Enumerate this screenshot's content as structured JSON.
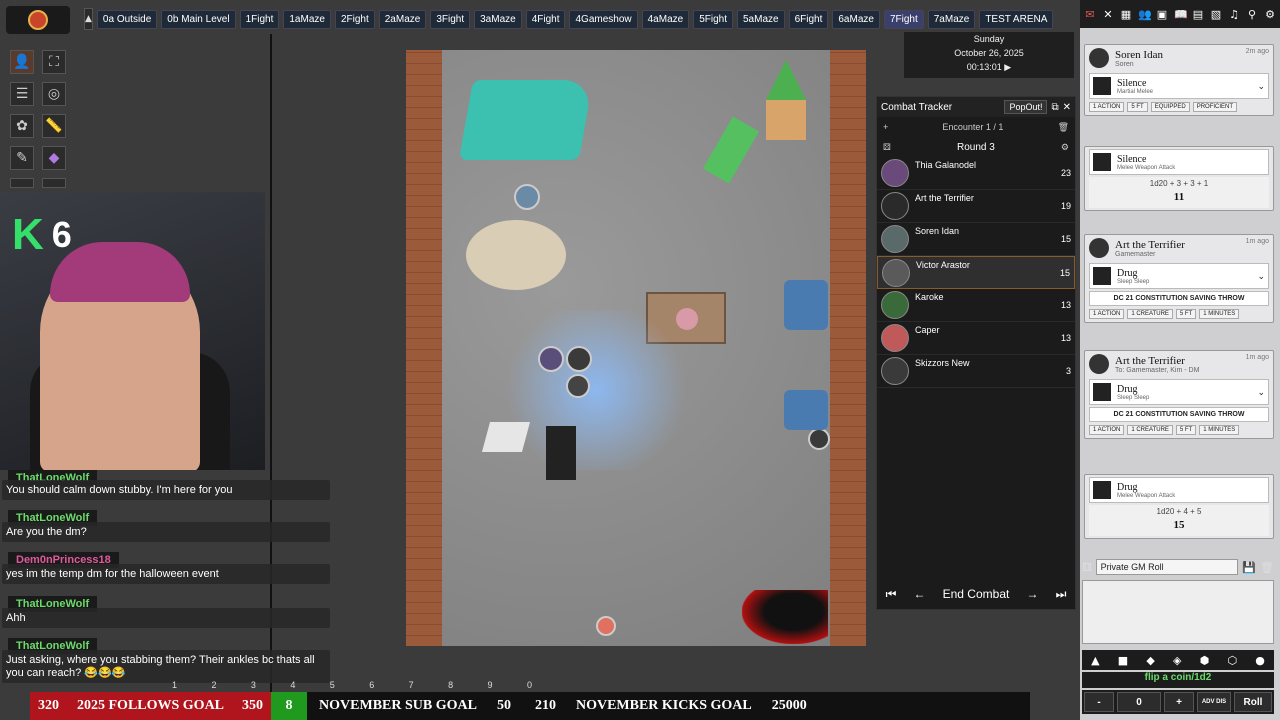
{
  "scenes": {
    "items": [
      {
        "label": "0a Outside"
      },
      {
        "label": "0b Main Level"
      },
      {
        "label": "1Fight"
      },
      {
        "label": "1aMaze"
      },
      {
        "label": "2Fight"
      },
      {
        "label": "2aMaze"
      },
      {
        "label": "3Fight"
      },
      {
        "label": "3aMaze"
      },
      {
        "label": "4Fight"
      },
      {
        "label": "4Gameshow"
      },
      {
        "label": "4aMaze"
      },
      {
        "label": "5Fight"
      },
      {
        "label": "5aMaze"
      },
      {
        "label": "6Fight"
      },
      {
        "label": "6aMaze"
      },
      {
        "label": "7Fight"
      },
      {
        "label": "7aMaze"
      },
      {
        "label": "TEST ARENA"
      }
    ],
    "active_index": 15
  },
  "webcam": {
    "badge_letter": "K",
    "badge_number": "6"
  },
  "chat": {
    "messages": [
      {
        "user": "ThatLoneWolf",
        "text": "You should calm down stubby. I'm here for you",
        "user_color": "green"
      },
      {
        "user": "ThatLoneWolf",
        "text": "Are you the dm?",
        "user_color": "green"
      },
      {
        "user": "Dem0nPrincess18",
        "text": "yes im the temp dm for the halloween event",
        "user_color": "pink"
      },
      {
        "user": "ThatLoneWolf",
        "text": "Ahh",
        "user_color": "green"
      },
      {
        "user": "ThatLoneWolf",
        "text": "Just asking, where you stabbing them? Their ankles bc thats all you can reach? 😂😂😂",
        "user_color": "green"
      }
    ]
  },
  "number_row": [
    "1",
    "2",
    "3",
    "4",
    "5",
    "6",
    "7",
    "8",
    "9",
    "0"
  ],
  "stats": {
    "follows_current": "320",
    "follows_label": "2025 FOLLOWS GOAL",
    "follows_goal": "350",
    "sub_current": "8",
    "sub_label": "NOVEMBER SUB GOAL",
    "sub_goal": "50",
    "kicks_current": "210",
    "kicks_label": "NOVEMBER KICKS GOAL",
    "kicks_goal": "25000"
  },
  "datetime": {
    "weekday": "Sunday",
    "date": "October 26, 2025",
    "time": "00:13:01 ▶"
  },
  "combat": {
    "title": "Combat Tracker",
    "popout": "PopOut!",
    "encounter": "Encounter 1 / 1",
    "round": "Round 3",
    "end_combat": "End Combat",
    "combatants": [
      {
        "name": "Thia Galanodel",
        "init": "23"
      },
      {
        "name": "Art the Terrifier",
        "init": "19"
      },
      {
        "name": "Soren Idan",
        "init": "15"
      },
      {
        "name": "Victor Arastor",
        "init": "15"
      },
      {
        "name": "Karoke",
        "init": "13"
      },
      {
        "name": "Caper",
        "init": "13"
      },
      {
        "name": "Skizzors New",
        "init": "3"
      }
    ],
    "active_index": 3
  },
  "chatlog": {
    "cards": [
      {
        "speaker": "Soren Idan",
        "speaker_sub": "Soren",
        "time": "2m ago",
        "item": "Silence",
        "item_sub": "Martial Melee",
        "tags": [
          "1 ACTION",
          "5 FT",
          "EQUIPPED",
          "PROFICIENT"
        ]
      },
      {
        "item": "Silence",
        "item_sub": "Melee Weapon Attack",
        "formula": "1d20 + 3 + 3 + 1",
        "total": "11"
      },
      {
        "speaker": "Art the Terrifier",
        "speaker_sub": "Gamemaster",
        "time": "1m ago",
        "item": "Drug",
        "item_sub": "Sleep Sleep",
        "dc": "DC 21 CONSTITUTION SAVING THROW",
        "tags": [
          "1 ACTION",
          "1 CREATURE",
          "5 FT",
          "1 MINUTES"
        ]
      },
      {
        "speaker": "Art the Terrifier",
        "speaker_sub": "To: Gamemaster, Kim - DM",
        "time": "1m ago",
        "item": "Drug",
        "item_sub": "Sleep Sleep",
        "dc": "DC 21 CONSTITUTION SAVING THROW",
        "tags": [
          "1 ACTION",
          "1 CREATURE",
          "5 FT",
          "1 MINUTES"
        ]
      },
      {
        "item": "Drug",
        "item_sub": "Melee Weapon Attack",
        "formula": "1d20 + 4 + 5",
        "total": "15"
      }
    ],
    "roll_mode": "Private GM Roll",
    "flip": "flip a coin/1d2",
    "roll_count": "0",
    "roll_button": "Roll",
    "adv_label": "ADV DIS"
  }
}
